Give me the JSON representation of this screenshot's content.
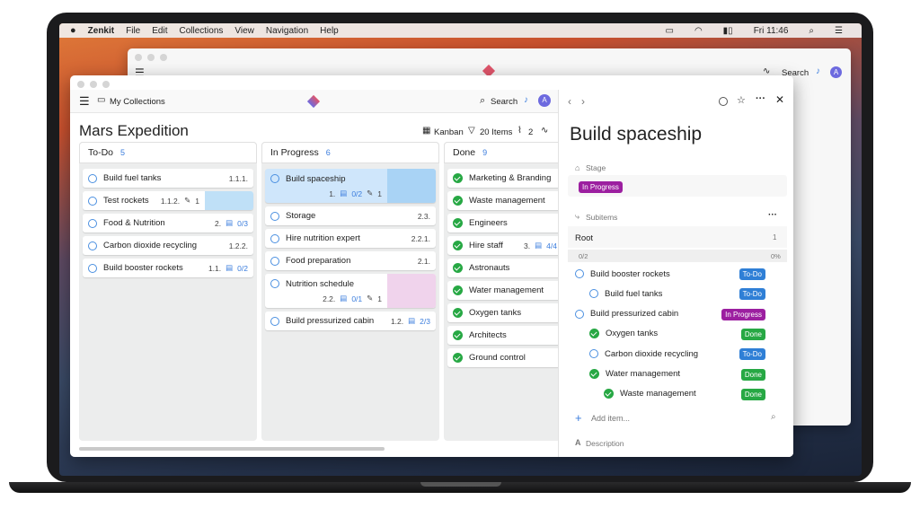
{
  "menubar": {
    "app": "Zenkit",
    "items": [
      "File",
      "Edit",
      "Collections",
      "View",
      "Navigation",
      "Help"
    ],
    "clock": "Fri 11:46"
  },
  "backwin": {
    "search": "Search",
    "avatar": "A"
  },
  "header": {
    "breadcrumb": "My Collections",
    "search": "Search",
    "avatar": "A"
  },
  "board": {
    "title": "Mars Expedition",
    "view": "Kanban",
    "items": "20 Items",
    "count": "2"
  },
  "columns": [
    {
      "name": "To-Do",
      "count": "5",
      "cards": [
        {
          "label": "Build fuel tanks",
          "num": "1.1.1.",
          "extra": "",
          "files": ""
        },
        {
          "label": "Test rockets",
          "num": "1.1.2.",
          "extra": "",
          "files": "1"
        },
        {
          "label": "Food & Nutrition",
          "num": "2.",
          "extra": "0/3",
          "files": ""
        },
        {
          "label": "Carbon dioxide recycling",
          "num": "1.2.2.",
          "extra": "",
          "files": ""
        },
        {
          "label": "Build booster rockets",
          "num": "1.1.",
          "extra": "0/2",
          "files": ""
        }
      ]
    },
    {
      "name": "In Progress",
      "count": "6",
      "cards": [
        {
          "label": "Build spaceship",
          "num": "1.",
          "extra": "0/2",
          "files": "1"
        },
        {
          "label": "Storage",
          "num": "2.3.",
          "extra": "",
          "files": ""
        },
        {
          "label": "Hire nutrition expert",
          "num": "2.2.1.",
          "extra": "",
          "files": ""
        },
        {
          "label": "Food preparation",
          "num": "2.1.",
          "extra": "",
          "files": ""
        },
        {
          "label": "Nutrition schedule",
          "num": "2.2.",
          "extra": "0/1",
          "files": "1"
        },
        {
          "label": "Build pressurized cabin",
          "num": "1.2.",
          "extra": "2/3",
          "files": ""
        }
      ]
    },
    {
      "name": "Done",
      "count": "9",
      "cards": [
        {
          "label": "Marketing & Branding",
          "num": "",
          "extra": "",
          "files": ""
        },
        {
          "label": "Waste management",
          "num": "",
          "extra": "",
          "files": ""
        },
        {
          "label": "Engineers",
          "num": "",
          "extra": "",
          "files": ""
        },
        {
          "label": "Hire staff",
          "num": "3.",
          "extra": "4/4",
          "files": ""
        },
        {
          "label": "Astronauts",
          "num": "",
          "extra": "",
          "files": ""
        },
        {
          "label": "Water management",
          "num": "",
          "extra": "",
          "files": ""
        },
        {
          "label": "Oxygen tanks",
          "num": "",
          "extra": "",
          "files": ""
        },
        {
          "label": "Architects",
          "num": "",
          "extra": "",
          "files": ""
        },
        {
          "label": "Ground control",
          "num": "",
          "extra": "",
          "files": ""
        }
      ]
    }
  ],
  "detail": {
    "title": "Build spaceship",
    "stage_label": "Stage",
    "stage_value": "In Progress",
    "subitems_label": "Subitems",
    "root": "Root",
    "root_count": "1",
    "progress_left": "0/2",
    "progress_right": "0%",
    "add_item": "Add item...",
    "description": "Description",
    "subitems": [
      {
        "label": "Build booster rockets",
        "status": "To-Do",
        "done": false,
        "indent": 0,
        "color": "#2f7fd6"
      },
      {
        "label": "Build fuel tanks",
        "status": "To-Do",
        "done": false,
        "indent": 1,
        "color": "#2f7fd6"
      },
      {
        "label": "Build pressurized cabin",
        "status": "In Progress",
        "done": false,
        "indent": 0,
        "color": "#9c1fa0"
      },
      {
        "label": "Oxygen tanks",
        "status": "Done",
        "done": true,
        "indent": 1,
        "color": "#27a844"
      },
      {
        "label": "Carbon dioxide recycling",
        "status": "To-Do",
        "done": false,
        "indent": 1,
        "color": "#2f7fd6"
      },
      {
        "label": "Water management",
        "status": "Done",
        "done": true,
        "indent": 1,
        "color": "#27a844"
      },
      {
        "label": "Waste management",
        "status": "Done",
        "done": true,
        "indent": 2,
        "color": "#27a844"
      }
    ]
  }
}
